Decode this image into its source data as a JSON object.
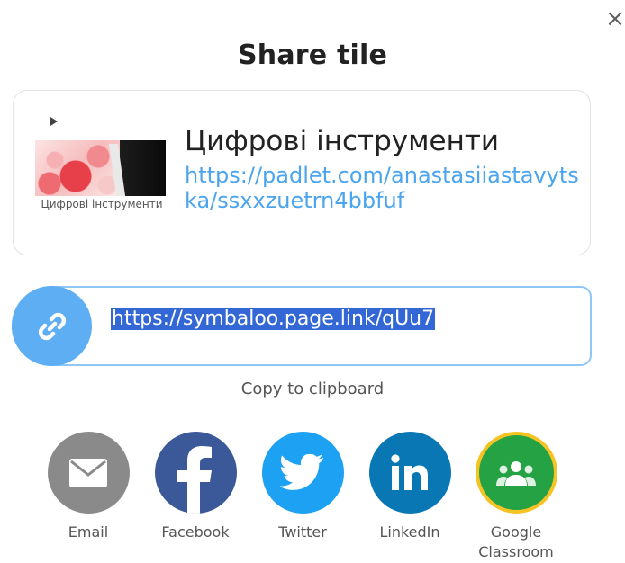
{
  "dialog": {
    "close_glyph": "×",
    "title": "Share tile"
  },
  "tile": {
    "name": "Цифрові інструменти",
    "url": "https://padlet.com/anastasiiastavytska/ssxxzuetrn4bbfuf",
    "thumbnail_caption": "Цифрові інструменти"
  },
  "share_link": {
    "value": "https://symbaloo.page.link/qUu7",
    "icon": "link-icon",
    "copy_label": "Copy to clipboard"
  },
  "share_targets": [
    {
      "label": "Email",
      "icon": "envelope-icon",
      "color": "#8a8a8a"
    },
    {
      "label": "Facebook",
      "icon": "facebook-icon",
      "color": "#3b5998"
    },
    {
      "label": "Twitter",
      "icon": "twitter-icon",
      "color": "#1da1f2"
    },
    {
      "label": "LinkedIn",
      "icon": "linkedin-icon",
      "color": "#0a77b5"
    },
    {
      "label": "Google Classroom",
      "icon": "google-classroom-icon",
      "color": "#25a244",
      "border": "#f6c325"
    }
  ],
  "colors": {
    "accent": "#5eaef3",
    "link": "#4aa4ee",
    "selection": "#3367d6"
  }
}
